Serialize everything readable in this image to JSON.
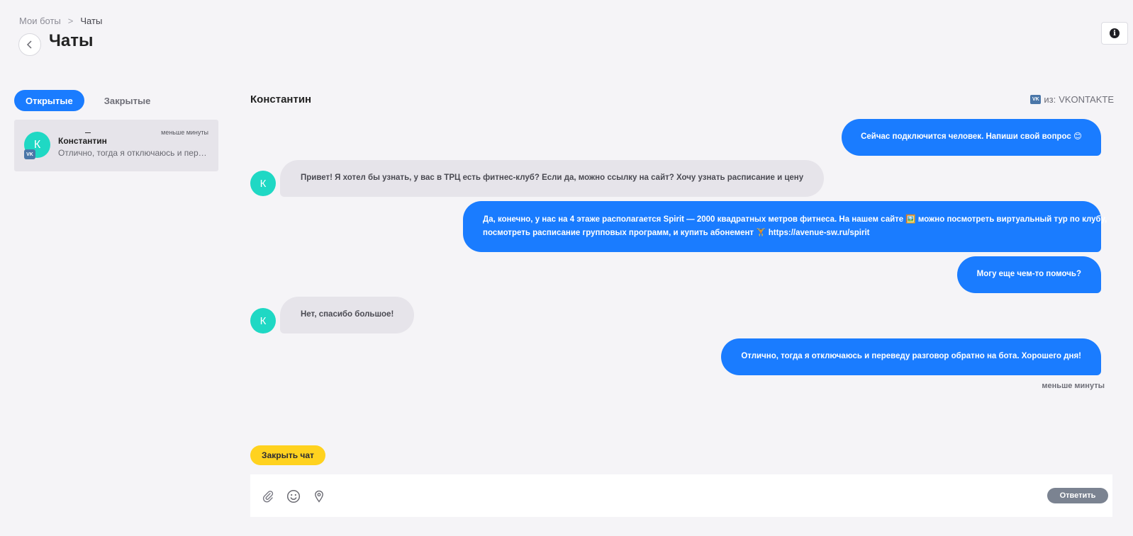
{
  "breadcrumb": {
    "parent": "Мои боты",
    "separator": ">",
    "current": "Чаты"
  },
  "header": {
    "title": "Чаты"
  },
  "tabs": [
    {
      "label": "Открытые",
      "active": true
    },
    {
      "label": "Закрытые",
      "active": false
    }
  ],
  "chat_list": [
    {
      "avatar_letter": "К",
      "badge": "VK",
      "name": "Константин",
      "preview": "Отлично, тогда я отключаюсь и переведу разговор обратно на бота. Хорошего дня!",
      "time": "меньше минуты"
    }
  ],
  "conversation": {
    "contact_name": "Константин",
    "source_prefix": "из:",
    "source_name": "VKONTAKTE",
    "messages": [
      {
        "direction": "out",
        "text": "Сейчас подключится человек. Напиши свой вопрос 😊"
      },
      {
        "direction": "in",
        "avatar_letter": "К",
        "text": "Привет! Я хотел бы узнать, у вас в ТРЦ есть фитнес-клуб? Если да, можно ссылку на сайт? Хочу узнать расписание и цену"
      },
      {
        "direction": "out",
        "text_line1": "Да, конечно, у нас на 4 этаже располагается Spirit — 2000 квадратных метров фитнеса. На нашем сайте 🖼️ можно посмотреть виртуальный тур по клубу,",
        "text_line2": "посмотреть расписание групповых программ, и купить абонемент 🏋️ https://avenue-sw.ru/spirit"
      },
      {
        "direction": "out",
        "text": "Могу еще чем-то помочь?"
      },
      {
        "direction": "in",
        "avatar_letter": "К",
        "text": "Нет, спасибо большое!"
      },
      {
        "direction": "out",
        "text": "Отлично, тогда я отключаюсь и переведу разговор обратно на бота. Хорошего дня!"
      }
    ],
    "last_message_time": "меньше минуты"
  },
  "actions": {
    "close_chat": "Закрыть чат",
    "reply": "Ответить"
  },
  "composer": {
    "placeholder": ""
  },
  "colors": {
    "accent": "#1a7cff",
    "avatar": "#1fd8c4",
    "close_button": "#ffd21f",
    "reply_button": "#7b8391",
    "vk": "#4a76a8"
  },
  "icons": [
    "back-arrow-icon",
    "info-icon",
    "vk-icon",
    "paperclip-icon",
    "smiley-icon",
    "location-pin-icon"
  ]
}
